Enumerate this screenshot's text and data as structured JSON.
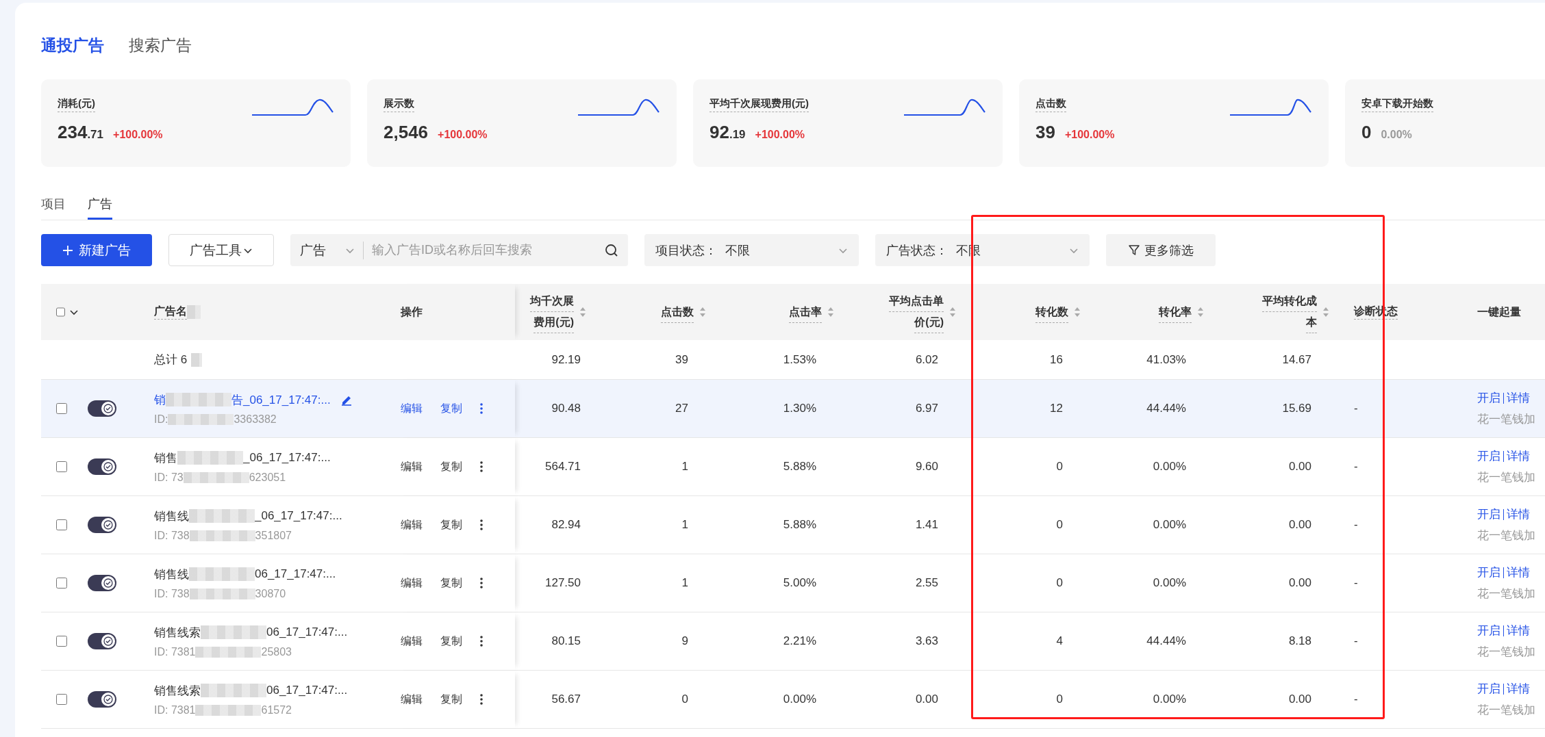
{
  "top_tabs": [
    {
      "label": "通投广告",
      "selected": true
    },
    {
      "label": "搜索广告",
      "selected": false
    }
  ],
  "metric_cards": [
    {
      "label": "消耗(元)",
      "value": "234",
      "decimal": ".71",
      "change": "+100.00%",
      "color": "#e5363a",
      "sparkline": true
    },
    {
      "label": "展示数",
      "value": "2,546",
      "change": "+100.00%",
      "color": "#e5363a",
      "sparkline": true
    },
    {
      "label": "平均千次展现费用(元)",
      "value": "92",
      "decimal": ".19",
      "change": "+100.00%",
      "color": "#e5363a",
      "sparkline": true
    },
    {
      "label": "点击数",
      "value": "39",
      "change": "+100.00%",
      "color": "#e5363a",
      "sparkline": true
    },
    {
      "label": "安卓下载开始数",
      "value": "0",
      "change": "0.00%",
      "color": "#999999",
      "sparkline": false
    }
  ],
  "sub_tabs": [
    {
      "label": "项目",
      "selected": false
    },
    {
      "label": "广告",
      "selected": true
    }
  ],
  "toolbar": {
    "new_button": "新建广告",
    "tools_button": "广告工具",
    "search": {
      "scope": "广告",
      "placeholder": "输入广告ID或名称后回车搜索"
    },
    "filters": [
      {
        "label": "项目状态：",
        "value": "不限"
      },
      {
        "label": "广告状态：",
        "value": "不限"
      }
    ],
    "more_filter": "更多筛选"
  },
  "table": {
    "select_all_checked": false,
    "name_header": "广告名",
    "ops_header": "操作",
    "columns": [
      {
        "lines": [
          "均千次展",
          "费用(元)"
        ],
        "sortable": true
      },
      {
        "lines": [
          "点击数"
        ],
        "sortable": true
      },
      {
        "lines": [
          "点击率"
        ],
        "sortable": true
      },
      {
        "lines": [
          "平均点击单",
          "价(元)"
        ],
        "sortable": true
      },
      {
        "lines": [
          "转化数"
        ],
        "sortable": true
      },
      {
        "lines": [
          "转化率"
        ],
        "sortable": true
      },
      {
        "lines": [
          "平均转化成",
          "本"
        ],
        "sortable": true
      },
      {
        "lines": [
          "诊断状态"
        ],
        "sortable": false
      },
      {
        "lines": [
          "一键起量"
        ],
        "sortable": false
      }
    ],
    "total": {
      "label": "总计 6",
      "values": [
        "92.19",
        "39",
        "1.53%",
        "6.02",
        "16",
        "41.03%",
        "14.67"
      ]
    },
    "rows": [
      {
        "selected": true,
        "checked": false,
        "on": true,
        "name_start": "销",
        "name_end": "告_06_17_17:47:...",
        "id_start": "ID: ",
        "id_end": "3363382",
        "actions": [
          "编辑",
          "复制"
        ],
        "values": [
          "90.48",
          "27",
          "1.30%",
          "6.97",
          "12",
          "44.44%",
          "15.69",
          "-"
        ],
        "boost": {
          "links": [
            "开启",
            "详情"
          ],
          "note": "花一笔钱加"
        }
      },
      {
        "selected": false,
        "checked": false,
        "on": true,
        "name_start": "销售",
        "name_end": "_06_17_17:47:...",
        "id_start": "ID: 73",
        "id_end": "623051",
        "actions": [
          "编辑",
          "复制"
        ],
        "values": [
          "564.71",
          "1",
          "5.88%",
          "9.60",
          "0",
          "0.00%",
          "0.00",
          "-"
        ],
        "boost": {
          "links": [
            "开启",
            "详情"
          ],
          "note": "花一笔钱加"
        }
      },
      {
        "selected": false,
        "checked": false,
        "on": true,
        "name_start": "销售线",
        "name_end": "_06_17_17:47:...",
        "id_start": "ID: 738",
        "id_end": "351807",
        "actions": [
          "编辑",
          "复制"
        ],
        "values": [
          "82.94",
          "1",
          "5.88%",
          "1.41",
          "0",
          "0.00%",
          "0.00",
          "-"
        ],
        "boost": {
          "links": [
            "开启",
            "详情"
          ],
          "note": "花一笔钱加"
        }
      },
      {
        "selected": false,
        "checked": false,
        "on": true,
        "name_start": "销售线",
        "name_end": "06_17_17:47:...",
        "id_start": "ID: 738",
        "id_end": "30870",
        "actions": [
          "编辑",
          "复制"
        ],
        "values": [
          "127.50",
          "1",
          "5.00%",
          "2.55",
          "0",
          "0.00%",
          "0.00",
          "-"
        ],
        "boost": {
          "links": [
            "开启",
            "详情"
          ],
          "note": "花一笔钱加"
        }
      },
      {
        "selected": false,
        "checked": false,
        "on": true,
        "name_start": "销售线索",
        "name_end": "06_17_17:47:...",
        "id_start": "ID: 7381",
        "id_end": "25803",
        "actions": [
          "编辑",
          "复制"
        ],
        "values": [
          "80.15",
          "9",
          "2.21%",
          "3.63",
          "4",
          "44.44%",
          "8.18",
          "-"
        ],
        "boost": {
          "links": [
            "开启",
            "详情"
          ],
          "note": "花一笔钱加"
        }
      },
      {
        "selected": false,
        "checked": false,
        "on": true,
        "name_start": "销售线索",
        "name_end": "06_17_17:47:...",
        "id_start": "ID: 7381",
        "id_end": "61572",
        "actions": [
          "编辑",
          "复制"
        ],
        "values": [
          "56.67",
          "0",
          "0.00%",
          "0.00",
          "0",
          "0.00%",
          "0.00",
          "-"
        ],
        "boost": {
          "links": [
            "开启",
            "详情"
          ],
          "note": "花一笔钱加"
        }
      }
    ]
  },
  "annotation": {
    "kind": "rectangle"
  }
}
